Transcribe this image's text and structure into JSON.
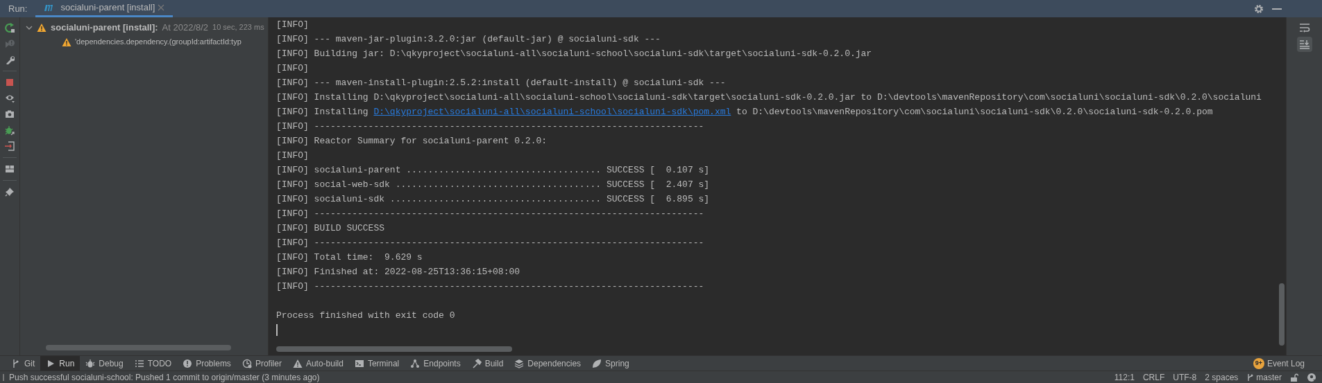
{
  "run_bar": {
    "label": "Run:",
    "tabs": [
      {
        "label": "socialuni-parent [install]",
        "selected": true
      }
    ]
  },
  "tree": [
    {
      "label": "socialuni-parent [install]:",
      "detail": "At 2022/8/2",
      "duration": "10 sec, 223 ms",
      "expanded": true,
      "children": [
        {
          "label": "'dependencies.dependency.(groupId:artifactId:typ"
        }
      ]
    }
  ],
  "console": {
    "lines": [
      {
        "text": "[INFO]"
      },
      {
        "text": "[INFO] --- maven-jar-plugin:3.2.0:jar (default-jar) @ socialuni-sdk ---"
      },
      {
        "text": "[INFO] Building jar: D:\\qkyproject\\socialuni-all\\socialuni-school\\socialuni-sdk\\target\\socialuni-sdk-0.2.0.jar"
      },
      {
        "text": "[INFO]"
      },
      {
        "text": "[INFO] --- maven-install-plugin:2.5.2:install (default-install) @ socialuni-sdk ---"
      },
      {
        "text": "[INFO] Installing D:\\qkyproject\\socialuni-all\\socialuni-school\\socialuni-sdk\\target\\socialuni-sdk-0.2.0.jar to D:\\devtools\\mavenRepository\\com\\socialuni\\socialuni-sdk\\0.2.0\\socialuni"
      },
      {
        "text": "[INFO] Installing",
        "link": "D:\\qkyproject\\socialuni-all\\socialuni-school\\socialuni-sdk\\pom.xml",
        "after": "to D:\\devtools\\mavenRepository\\com\\socialuni\\socialuni-sdk\\0.2.0\\socialuni-sdk-0.2.0.pom"
      },
      {
        "text": "[INFO] ------------------------------------------------------------------------"
      },
      {
        "text": "[INFO] Reactor Summary for socialuni-parent 0.2.0:"
      },
      {
        "text": "[INFO]"
      },
      {
        "text": "[INFO] socialuni-parent .................................... SUCCESS [  0.107 s]"
      },
      {
        "text": "[INFO] social-web-sdk ...................................... SUCCESS [  2.407 s]"
      },
      {
        "text": "[INFO] socialuni-sdk ....................................... SUCCESS [  6.895 s]"
      },
      {
        "text": "[INFO] ------------------------------------------------------------------------"
      },
      {
        "text": "[INFO] BUILD SUCCESS"
      },
      {
        "text": "[INFO] ------------------------------------------------------------------------"
      },
      {
        "text": "[INFO] Total time:  9.629 s"
      },
      {
        "text": "[INFO] Finished at: 2022-08-25T13:36:15+08:00"
      },
      {
        "text": "[INFO] ------------------------------------------------------------------------"
      },
      {
        "text": "Process finished with exit code 0",
        "kind": "exit_message"
      }
    ],
    "cursor": true
  },
  "tool_windows": [
    {
      "label": "Git",
      "selected": false
    },
    {
      "label": "Run",
      "selected": true
    },
    {
      "label": "Debug",
      "selected": false
    },
    {
      "label": "TODO",
      "selected": false
    },
    {
      "label": "Problems",
      "selected": false
    },
    {
      "label": "Profiler",
      "selected": false
    },
    {
      "label": "Auto-build",
      "selected": false
    },
    {
      "label": "Terminal",
      "selected": false
    },
    {
      "label": "Endpoints",
      "selected": false
    },
    {
      "label": "Build",
      "selected": false
    },
    {
      "label": "Dependencies",
      "selected": false
    },
    {
      "label": "Spring",
      "selected": false
    }
  ],
  "event_log": {
    "badge": "9+",
    "label": "Event Log"
  },
  "status_bar": {
    "message": "Push successful socialuni-school: Pushed 1 commit to origin/master (3 minutes ago)",
    "items": [
      "112:1",
      "CRLF",
      "UTF-8",
      "2 spaces"
    ],
    "branch": "master"
  }
}
